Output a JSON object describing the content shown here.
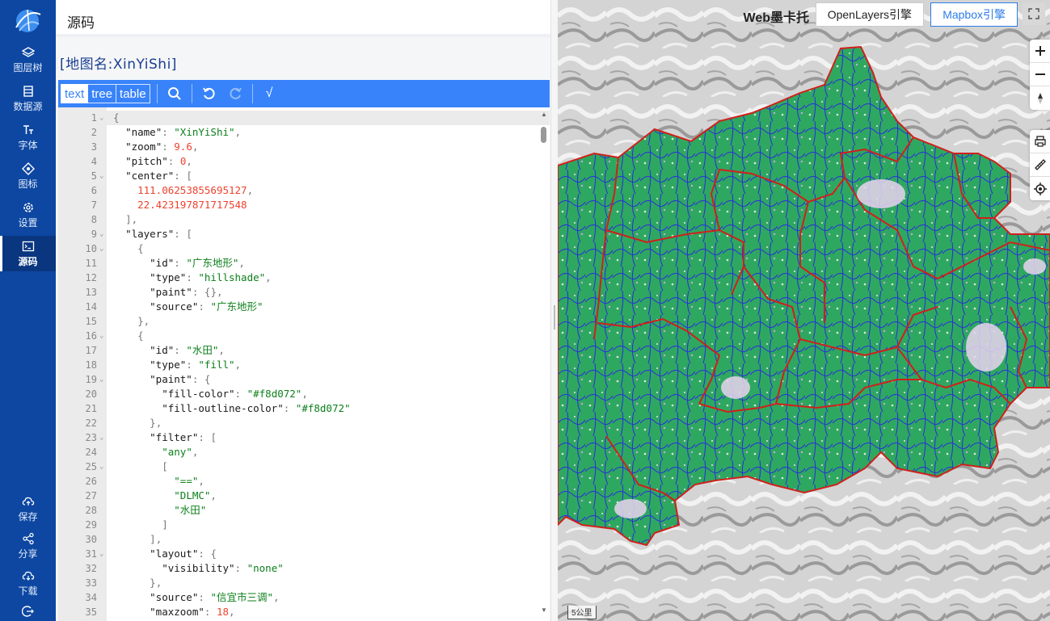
{
  "sidebar": {
    "items": [
      {
        "label": "图层树",
        "icon": "layers-icon"
      },
      {
        "label": "数据源",
        "icon": "database-icon"
      },
      {
        "label": "字体",
        "icon": "font-icon"
      },
      {
        "label": "图标",
        "icon": "symbol-icon"
      },
      {
        "label": "设置",
        "icon": "gear-icon"
      },
      {
        "label": "源码",
        "icon": "terminal-icon"
      }
    ],
    "bottom_items": [
      {
        "label": "保存",
        "icon": "cloud-upload-icon"
      },
      {
        "label": "分享",
        "icon": "share-icon"
      },
      {
        "label": "下载",
        "icon": "cloud-download-icon"
      }
    ],
    "active": "源码"
  },
  "panel": {
    "title": "源码",
    "map_name": "[地图名:XinYiShi]"
  },
  "toolbar": {
    "modes": [
      "text",
      "tree",
      "table"
    ],
    "active_mode": "text",
    "check_label": "√"
  },
  "editor": {
    "lines": [
      {
        "n": "1",
        "fold": true,
        "text": "{"
      },
      {
        "n": "2",
        "text": "  \"name\": \"XinYiShi\","
      },
      {
        "n": "3",
        "text": "  \"zoom\": 9.6,"
      },
      {
        "n": "4",
        "text": "  \"pitch\": 0,"
      },
      {
        "n": "5",
        "fold": true,
        "text": "  \"center\": ["
      },
      {
        "n": "6",
        "text": "    111.06253855695127,"
      },
      {
        "n": "7",
        "text": "    22.423197871717548"
      },
      {
        "n": "8",
        "text": "  ],"
      },
      {
        "n": "9",
        "fold": true,
        "text": "  \"layers\": ["
      },
      {
        "n": "10",
        "fold": true,
        "text": "    {"
      },
      {
        "n": "11",
        "text": "      \"id\": \"广东地形\","
      },
      {
        "n": "12",
        "text": "      \"type\": \"hillshade\","
      },
      {
        "n": "13",
        "text": "      \"paint\": {},"
      },
      {
        "n": "14",
        "text": "      \"source\": \"广东地形\""
      },
      {
        "n": "15",
        "text": "    },"
      },
      {
        "n": "16",
        "fold": true,
        "text": "    {"
      },
      {
        "n": "17",
        "text": "      \"id\": \"水田\","
      },
      {
        "n": "18",
        "text": "      \"type\": \"fill\","
      },
      {
        "n": "19",
        "fold": true,
        "text": "      \"paint\": {"
      },
      {
        "n": "20",
        "text": "        \"fill-color\": \"#f8d072\","
      },
      {
        "n": "21",
        "text": "        \"fill-outline-color\": \"#f8d072\""
      },
      {
        "n": "22",
        "text": "      },"
      },
      {
        "n": "23",
        "fold": true,
        "text": "      \"filter\": ["
      },
      {
        "n": "24",
        "text": "        \"any\","
      },
      {
        "n": "25",
        "fold": true,
        "text": "        ["
      },
      {
        "n": "26",
        "text": "          \"==\","
      },
      {
        "n": "27",
        "text": "          \"DLMC\","
      },
      {
        "n": "28",
        "text": "          \"水田\""
      },
      {
        "n": "29",
        "text": "        ]"
      },
      {
        "n": "30",
        "text": "      ],"
      },
      {
        "n": "31",
        "fold": true,
        "text": "      \"layout\": {"
      },
      {
        "n": "32",
        "text": "        \"visibility\": \"none\""
      },
      {
        "n": "33",
        "text": "      },"
      },
      {
        "n": "34",
        "text": "      \"source\": \"信宜市三调\","
      },
      {
        "n": "35",
        "text": "      \"maxzoom\": 18,"
      }
    ]
  },
  "map": {
    "title": "Web墨卡托",
    "engines": [
      "OpenLayers引擎",
      "Mapbox引擎"
    ],
    "active_engine": "Mapbox引擎",
    "scale_label": "5公里",
    "colors": {
      "land_fill": "#2ea860",
      "district_border": "#d0201a",
      "village_border": "#2030d8",
      "hillshade": "#cfcfcf"
    }
  }
}
